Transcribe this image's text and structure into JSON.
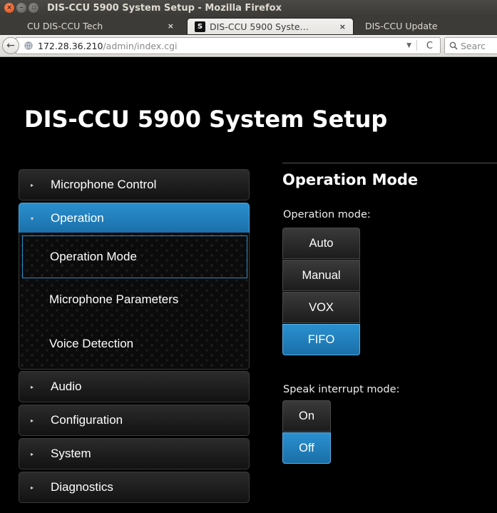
{
  "window": {
    "title": "DIS-CCU 5900 System Setup - Mozilla Firefox",
    "close_glyph": "×",
    "min_glyph": "–",
    "max_glyph": "▫"
  },
  "tabs": [
    {
      "label": "CU DIS-CCU Tech",
      "close": "×"
    },
    {
      "label": "DIS-CCU 5900 Syste…",
      "close": "×",
      "favicon": "S"
    },
    {
      "label": "DIS-CCU Update"
    }
  ],
  "navbar": {
    "back_glyph": "←",
    "url_host": "172.28.36.210",
    "url_path": "/admin/index.cgi",
    "dropdown_glyph": "▼",
    "reload_glyph": "C",
    "search_placeholder": "Searc"
  },
  "page": {
    "title": "DIS-CCU 5900 System Setup"
  },
  "sidebar": {
    "items": [
      {
        "label": "Microphone Control",
        "caret": "▸"
      },
      {
        "label": "Operation",
        "caret": "▾"
      },
      {
        "label": "Audio",
        "caret": "▸"
      },
      {
        "label": "Configuration",
        "caret": "▸"
      },
      {
        "label": "System",
        "caret": "▸"
      },
      {
        "label": "Diagnostics",
        "caret": "▸"
      }
    ],
    "sub_items": [
      {
        "label": "Operation Mode",
        "selected": true
      },
      {
        "label": "Microphone Parameters"
      },
      {
        "label": "Voice Detection"
      }
    ]
  },
  "content": {
    "section_title": "Operation Mode",
    "operation_mode": {
      "label": "Operation mode:",
      "options": [
        "Auto",
        "Manual",
        "VOX",
        "FIFO"
      ],
      "selected": "FIFO"
    },
    "speak_interrupt": {
      "label": "Speak interrupt mode:",
      "options": [
        "On",
        "Off"
      ],
      "selected": "Off"
    }
  },
  "colors": {
    "accent": "#1f7fbd",
    "background": "#000000",
    "chrome": "#3c3b37"
  }
}
